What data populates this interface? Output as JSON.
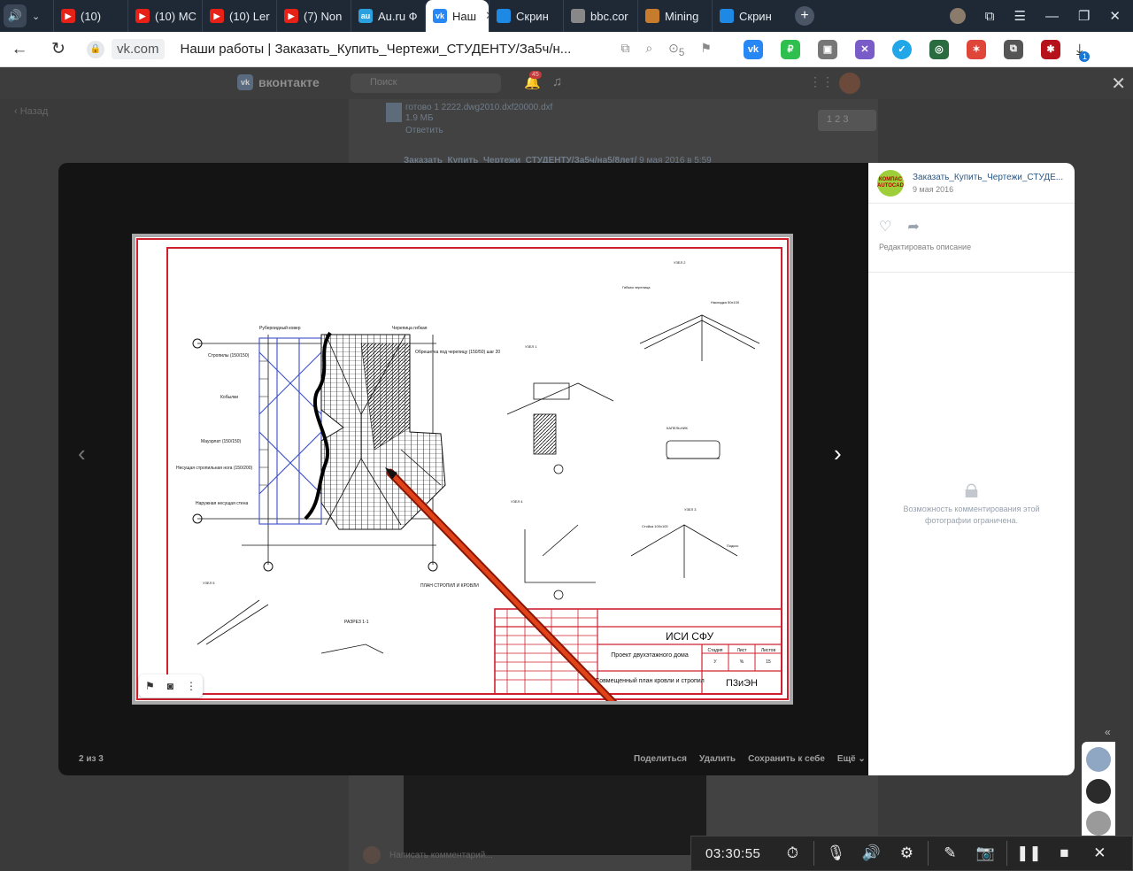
{
  "browser": {
    "tabs": [
      {
        "label": "(10)",
        "icon": "youtube-icon",
        "color": "#e62117"
      },
      {
        "label": "(10) MC",
        "icon": "youtube-icon",
        "color": "#e62117"
      },
      {
        "label": "(10) Ler",
        "icon": "youtube-icon",
        "color": "#e62117"
      },
      {
        "label": "(7) Non",
        "icon": "youtube-icon",
        "color": "#e62117"
      },
      {
        "label": "Au.ru Ф",
        "icon": "auru-icon",
        "color": "#2aa1de"
      },
      {
        "label": "Наш",
        "icon": "vk-icon",
        "color": "#2787f5",
        "active": true
      },
      {
        "label": "Скрин",
        "icon": "screenshot-icon",
        "color": "#1e88e5"
      },
      {
        "label": "bbc.cor",
        "icon": "page-icon",
        "color": "#888888"
      },
      {
        "label": "Mining",
        "icon": "mining-icon",
        "color": "#c77b2c"
      },
      {
        "label": "Скрин",
        "icon": "screenshot-icon",
        "color": "#1e88e5"
      }
    ],
    "url_domain": "vk.com",
    "page_title": "Наши работы | Заказать_Купить_Чертежи_СТУДЕНТУ/За5ч/н...",
    "tab_count_badge": "5",
    "downloads_badge": "1"
  },
  "vk": {
    "logo_text": "вконтакте",
    "search_placeholder": "Поиск",
    "notifications_badge": "45",
    "back_link": "Назад",
    "file_name": "готово 1 2222.dwg2010.dxf20000.dxf",
    "file_size": "1.9 МБ",
    "reply": "Ответить",
    "pager": "1  2  3",
    "post_author": "Заказать_Купить_Чертежи_СТУДЕНТУ/За5ч/на5/8лет/",
    "post_date": "9 мая 2016 в 5:59",
    "comment_placeholder": "Написать комментарий..."
  },
  "viewer": {
    "counter": "2 из 3",
    "actions": [
      "Поделиться",
      "Удалить",
      "Сохранить к себе",
      "Ещё ⌄"
    ]
  },
  "sidebar": {
    "avatar_text": "КОМПАС AUTOCAD",
    "author": "Заказать_Купить_Чертежи_СТУДЕ...",
    "date": "9 мая 2016",
    "edit_description": "Редактировать описание",
    "comments_restricted": "Возможность комментирования этой фотографии ограничена."
  },
  "drawing": {
    "title_org": "ИСИ СФУ",
    "title_project": "Проект двухэтажного дома",
    "title_sheet": "Совмещенный план кровли и стропил",
    "title_code": "П3иЭН",
    "plan_label": "ПЛАН СТРОПИЛ И КРОВЛИ",
    "section_label": "РАЗРЕЗ 1-1",
    "stage_headers": [
      "Стадия",
      "Лист",
      "Листов"
    ],
    "stage_values": [
      "У",
      "%",
      "15"
    ],
    "annotations": [
      "Рубероидный ковер",
      "Черепица гибкая",
      "Обрешетка под черепицу (150/50) шаг 20",
      "Стропилы (150/150)",
      "Кобылки",
      "Мауэрлат (150/150)",
      "Несущая стропильная нога (150/200)",
      "Наружная несущая стена"
    ],
    "colors": {
      "frame": "#d0202e",
      "lines": "#111111",
      "rafters": "#3a4fc8",
      "pointer": "#c62a10"
    }
  },
  "recorder": {
    "time": "03:30:55"
  }
}
